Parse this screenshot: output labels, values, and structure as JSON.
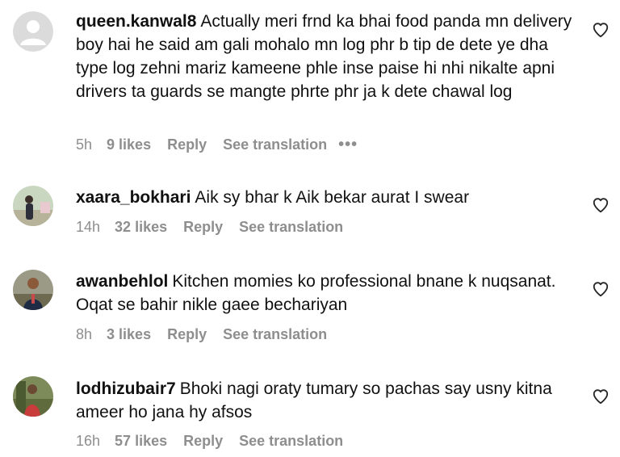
{
  "comments": [
    {
      "username": "queen.kanwal8",
      "text": "Actually meri frnd ka bhai food panda mn delivery boy hai he said am gali mohalo mn log phr b tip de dete ye dha type log zehni mariz kameene phle inse paise hi nhi nikalte apni drivers ta guards se mangte phrte phr ja k dete chawal log",
      "time": "5h",
      "likes": "9 likes",
      "reply": "Reply",
      "translation": "See translation",
      "more": "•••"
    },
    {
      "username": "xaara_bokhari",
      "text": "Aik sy bhar k Aik bekar aurat I swear",
      "time": "14h",
      "likes": "32 likes",
      "reply": "Reply",
      "translation": "See translation"
    },
    {
      "username": "awanbehlol",
      "text": "Kitchen momies ko professional bnane k nuqsanat. Oqat se bahir nikle gaee bechariyan",
      "time": "8h",
      "likes": "3 likes",
      "reply": "Reply",
      "translation": "See translation"
    },
    {
      "username": "lodhizubair7",
      "text": "Bhoki nagi oraty tumary so pachas say usny kitna ameer ho jana hy afsos",
      "time": "16h",
      "likes": "57 likes",
      "reply": "Reply",
      "translation": "See translation"
    }
  ],
  "colors": {
    "text": "#111111",
    "meta": "#8e8e8e",
    "default_avatar_bg": "#dbdbdb",
    "default_avatar_fg": "#ffffff"
  },
  "icons": {
    "heart": "heart-outline-icon",
    "default_avatar": "default-profile-icon"
  }
}
